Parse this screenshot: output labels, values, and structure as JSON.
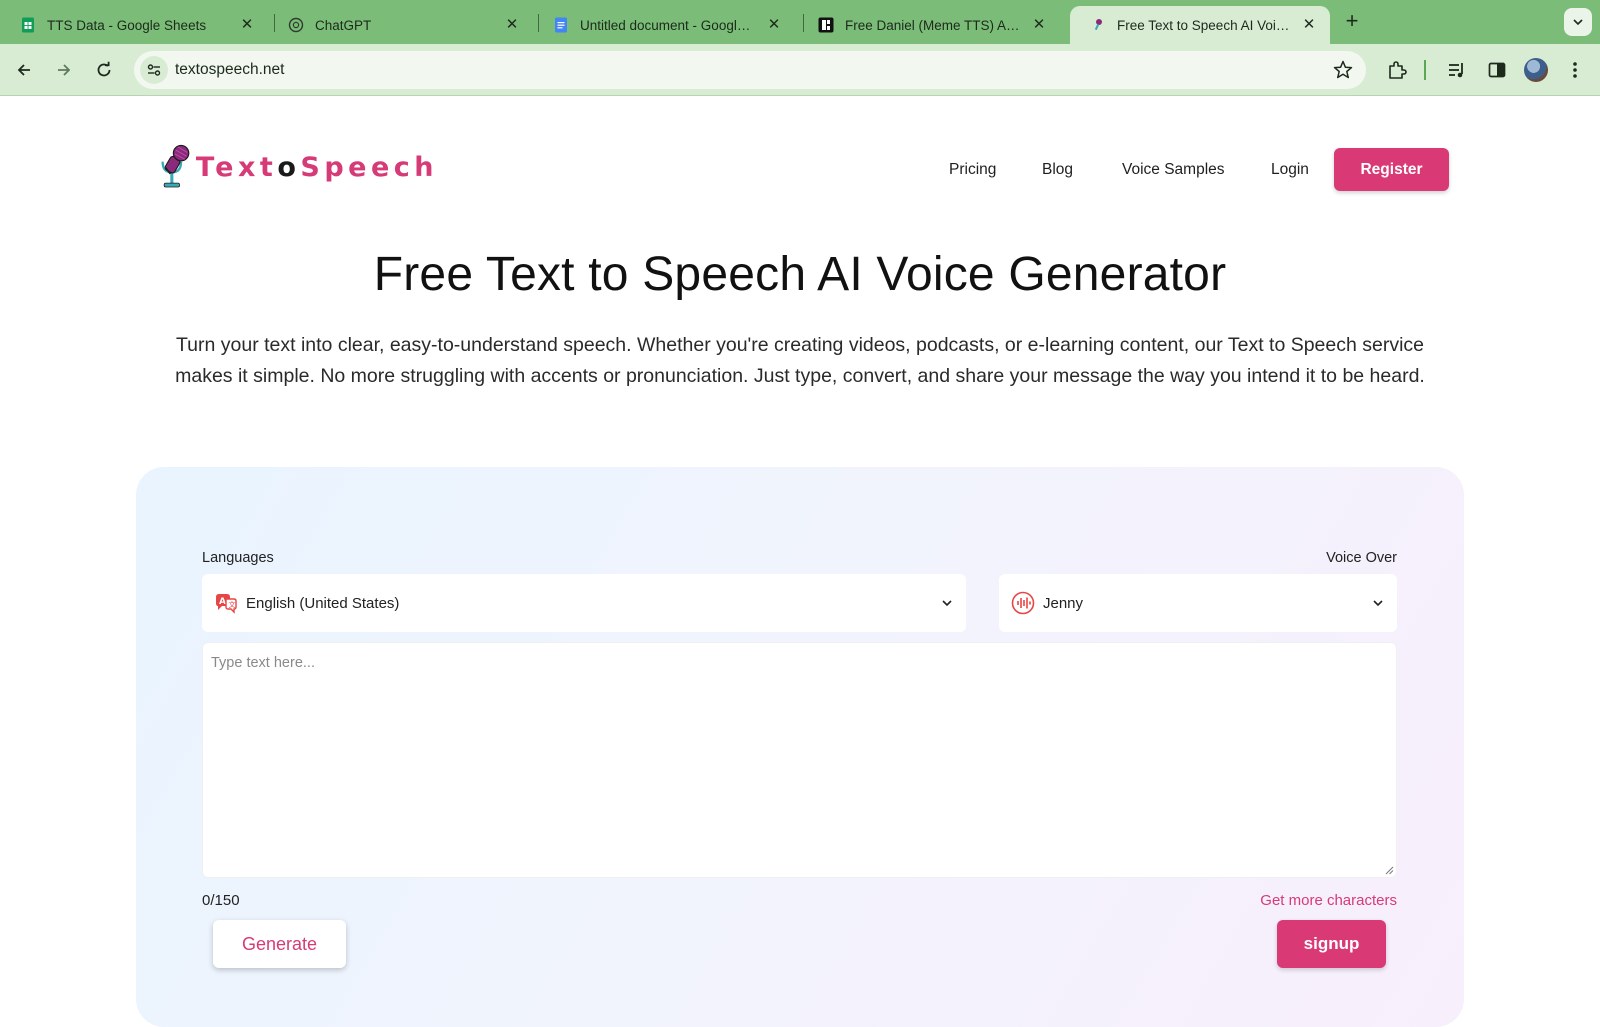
{
  "browser": {
    "tabs": [
      {
        "title": "TTS Data - Google Sheets",
        "icon": "google-sheets-icon"
      },
      {
        "title": "ChatGPT",
        "icon": "chatgpt-icon"
      },
      {
        "title": "Untitled document - Google Docs",
        "icon": "google-docs-icon"
      },
      {
        "title": "Free Daniel (Meme TTS) AI Voice",
        "icon": "voice-site-icon"
      },
      {
        "title": "Free Text to Speech AI Voice Generator",
        "icon": "microphone-favicon",
        "active": true
      }
    ],
    "url": "textospeech.net"
  },
  "site": {
    "logo_prefix": "Texto",
    "logo_o": "o",
    "logo_suffix": "Speech",
    "nav": {
      "pricing": "Pricing",
      "blog": "Blog",
      "voice_samples": "Voice Samples",
      "login": "Login",
      "register": "Register"
    },
    "accent_color": "#d93a76"
  },
  "hero": {
    "title": "Free Text to Speech AI Voice Generator",
    "subtitle": "Turn your text into clear, easy-to-understand speech. Whether you're creating videos, podcasts, or e-learning content, our Text to Speech service makes it simple. No more struggling with accents or pronunciation. Just type, convert, and share your message the way you intend it to be heard."
  },
  "generator": {
    "languages_label": "Languages",
    "voice_label": "Voice Over",
    "language_value": "English (United States)",
    "voice_value": "Jenny",
    "text_placeholder": "Type text here...",
    "char_count": "0/150",
    "more_chars_link": "Get more characters",
    "generate_button": "Generate",
    "signup_button": "signup"
  }
}
